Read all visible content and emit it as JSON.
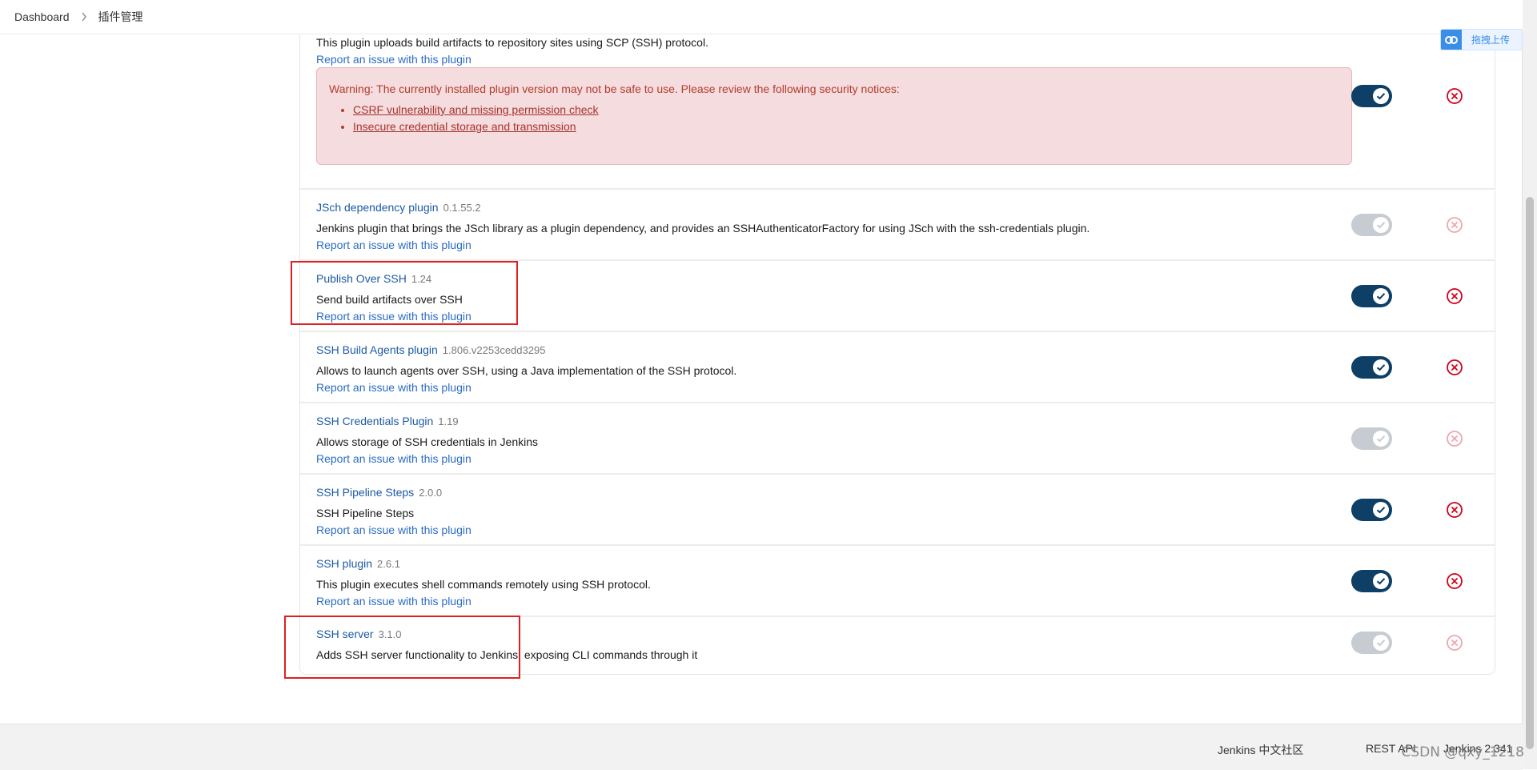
{
  "breadcrumb": {
    "items": [
      "Dashboard",
      "插件管理"
    ]
  },
  "upload": {
    "label": "拖拽上传"
  },
  "top_plugin": {
    "description": "This plugin uploads build artifacts to repository sites using SCP (SSH) protocol.",
    "report": "Report an issue with this plugin",
    "warning_title": "Warning: The currently installed plugin version may not be safe to use. Please review the following security notices:",
    "warnings": [
      "CSRF vulnerability and missing permission check",
      "Insecure credential storage and transmission"
    ],
    "enabled": true
  },
  "plugins": [
    {
      "name": "JSch dependency plugin",
      "version": "0.1.55.2",
      "description": "Jenkins plugin that brings the JSch library as a plugin dependency, and provides an SSHAuthenticatorFactory for using JSch with the ssh-credentials plugin.",
      "report": "Report an issue with this plugin",
      "enabled": true,
      "toggle_disabled": true
    },
    {
      "name": "Publish Over SSH",
      "version": "1.24",
      "description": "Send build artifacts over SSH",
      "report": "Report an issue with this plugin",
      "enabled": true,
      "toggle_disabled": false
    },
    {
      "name": "SSH Build Agents plugin",
      "version": "1.806.v2253cedd3295",
      "description": "Allows to launch agents over SSH, using a Java implementation of the SSH protocol.",
      "report": "Report an issue with this plugin",
      "enabled": true,
      "toggle_disabled": false
    },
    {
      "name": "SSH Credentials Plugin",
      "version": "1.19",
      "description": "Allows storage of SSH credentials in Jenkins",
      "report": "Report an issue with this plugin",
      "enabled": true,
      "toggle_disabled": true
    },
    {
      "name": "SSH Pipeline Steps",
      "version": "2.0.0",
      "description": "SSH Pipeline Steps",
      "report": "Report an issue with this plugin",
      "enabled": true,
      "toggle_disabled": false
    },
    {
      "name": "SSH plugin",
      "version": "2.6.1",
      "description": "This plugin executes shell commands remotely using SSH protocol.",
      "report": "Report an issue with this plugin",
      "enabled": true,
      "toggle_disabled": false
    },
    {
      "name": "SSH server",
      "version": "3.1.0",
      "description": "Adds SSH server functionality to Jenkins, exposing CLI commands through it",
      "enabled": true,
      "toggle_disabled": true
    }
  ],
  "footer": {
    "community": "Jenkins 中文社区",
    "rest_api": "REST API",
    "version": "Jenkins 2.341"
  },
  "watermark": "CSDN @qxy_1218",
  "colors": {
    "link": "#1c5aa6",
    "toggle_on": "#0e3f66",
    "danger": "#d0021b",
    "warning_bg": "#f4dcdf",
    "highlight": "#e02020"
  }
}
